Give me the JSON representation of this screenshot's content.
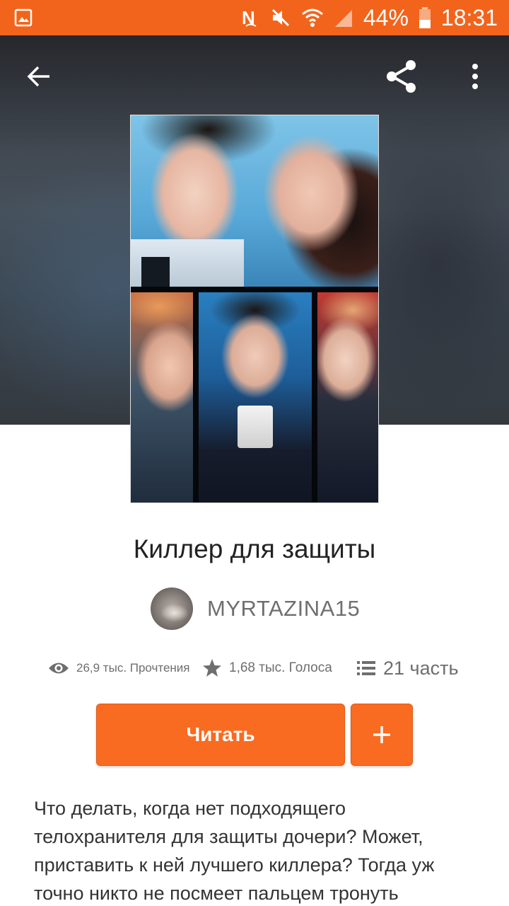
{
  "status_bar": {
    "battery": "44%",
    "time": "18:31",
    "icons": [
      "gallery-icon",
      "n-icon",
      "mute-icon",
      "wifi-icon",
      "signal-icon",
      "battery-icon"
    ]
  },
  "toolbar": {
    "back_icon": "arrow-back-icon",
    "share_icon": "share-icon",
    "more_icon": "more-vert-icon"
  },
  "story": {
    "title": "Киллер для защиты",
    "author": "MYRTAZINA15",
    "reads": "26,9 тыс. Прочтения",
    "votes": "1,68 тыс. Голоса",
    "parts": "21 часть",
    "read_button": "Читать",
    "add_button_icon": "plus-icon",
    "description": "Что делать, когда нет подходящего телохранителя для защиты дочери? Может, приставить к ней лучшего киллера? Тогда уж точно никто не посмеет пальцем тронуть"
  },
  "colors": {
    "accent": "#f96b21",
    "status_bar": "#f2641b"
  }
}
